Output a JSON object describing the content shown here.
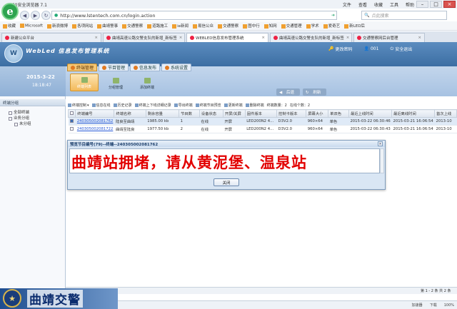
{
  "browser": {
    "title": "360安全浏览器 7.1",
    "menu": [
      "文件",
      "查看",
      "收藏",
      "工具",
      "帮助"
    ],
    "url": "http://www.lstentech.com.cn/login.action",
    "search_placeholder": "点此搜索",
    "favorites": [
      "收藏",
      "Microsoft",
      "新浪微博",
      "各项网站",
      "曲靖警事",
      "交通警察",
      "道路施工",
      "ie新闻",
      "易信公众",
      "交通警察",
      "图中行",
      "知网",
      "交通管理",
      "学术",
      "爱奇艺",
      "新LED后"
    ],
    "tabs": [
      {
        "label": "新建公众平台",
        "active": false
      },
      {
        "label": "曲靖高速公路交警支队的新增_新标签",
        "active": false
      },
      {
        "label": "WEBLED信息发布管理系统",
        "active": true
      },
      {
        "label": "曲靖高速公路交警支队的新增_新标签",
        "active": false
      },
      {
        "label": "交通警察网后台管理",
        "active": false
      }
    ]
  },
  "app": {
    "logo": "W",
    "title": "WebLed 信息发布管理系统",
    "links": [
      "更改密码",
      "001",
      "安全退出"
    ],
    "date": "2015-3-22",
    "time": "18:18:47",
    "main_tabs": [
      {
        "label": "终端管理",
        "active": true
      },
      {
        "label": "节目管理",
        "active": false
      },
      {
        "label": "信息发布",
        "active": false
      },
      {
        "label": "系统设置",
        "active": false
      }
    ],
    "sub_buttons": [
      {
        "label": "终端列表",
        "active": true
      },
      {
        "label": "分组管理",
        "active": false
      },
      {
        "label": "添加终端",
        "active": false
      }
    ],
    "nav": {
      "back": "后退",
      "refresh": "刷新"
    }
  },
  "tree": {
    "header": "终端分组",
    "items": [
      "全部终端",
      "业务分组",
      "未分组"
    ]
  },
  "toolbar": [
    "终端控制",
    "信息在线",
    "历史记录",
    "终端上下线详细记录",
    "导出终端",
    "终端节目预览",
    "更新终端",
    "删除终端",
    "终端数量：2",
    "在线个数：2"
  ],
  "table": {
    "columns": [
      "",
      "终端编号",
      "终端名称",
      "剩余容量",
      "节目数",
      "设备状态",
      "开屏/关屏",
      "固件版本",
      "控制卡版本",
      "屏幕大小",
      "单双色",
      "最近上线时间",
      "最近离线时间",
      "首次上线"
    ],
    "rows": [
      {
        "selected": true,
        "cells": [
          "240305002081762",
          "陆良至曲靖",
          "1985.00 kb",
          "1",
          "在线",
          "开屏",
          "LED200N2 4...",
          "D3V2.0",
          "960×64",
          "单色",
          "2015-03-22 06:30:46",
          "2015-03-21 16:06:54",
          "2013-10"
        ]
      },
      {
        "selected": false,
        "cells": [
          "240305002081722",
          "曲靖至陆良",
          "1977.50 kb",
          "2",
          "在线",
          "开屏",
          "LED200N2 4...",
          "D3V2.0",
          "960×64",
          "单色",
          "2015-03-22 06:30:43",
          "2015-03-21 16:06:54",
          "2013-10"
        ]
      }
    ]
  },
  "modal": {
    "title": "预览节目编号(79)--终端--240305002081762",
    "led_text": "曲靖站拥堵，请从黄泥堡、温泉站",
    "close_label": "关闭"
  },
  "footer": {
    "logo_text": "曲靖交警",
    "pager_info": "第 1 - 2 条 共 2 条"
  },
  "statusbar": [
    "加速器",
    "下载",
    "100%"
  ]
}
